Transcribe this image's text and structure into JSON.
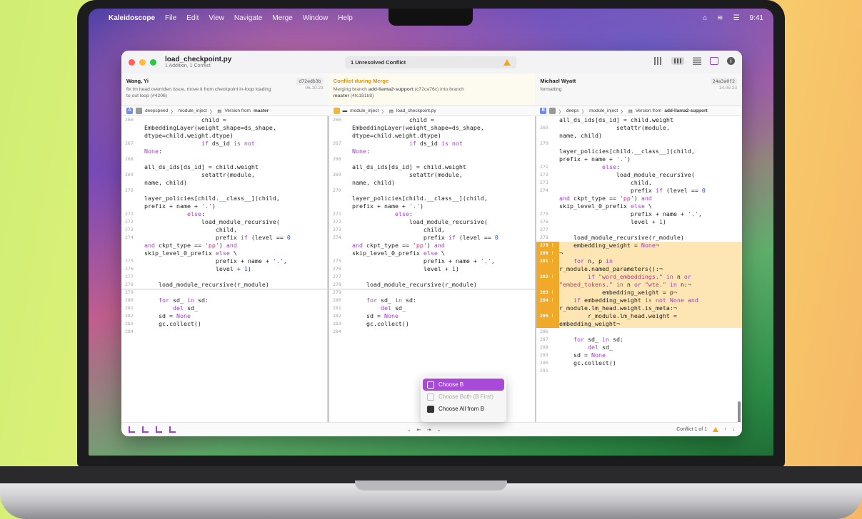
{
  "menubar": {
    "app": "Kaleidoscope",
    "items": [
      "File",
      "Edit",
      "View",
      "Navigate",
      "Merge",
      "Window",
      "Help"
    ],
    "clock": "9:41"
  },
  "window": {
    "title": "load_checkpoint.py",
    "subtitle": "1 Addition, 1 Conflict",
    "conflict_pill": "1 Unresolved Conflict"
  },
  "info": {
    "left": {
      "author": "Wang, Yi",
      "hash": "d72edb3b",
      "date": "06.10.23",
      "message": "fix lm head overriden issue, move it from checkpoint in-loop loading to out loop (#4206)"
    },
    "middle": {
      "title": "Conflict during Merge",
      "message_pre": "Merging branch ",
      "branch": "add-llama2-support",
      "message_mid": " (c72ca76c) into branch ",
      "target": "master",
      "message_post": " (4fc181b8)"
    },
    "right": {
      "author": "Michael Wyatt",
      "hash": "24a3a0f2",
      "date": "14.09.23",
      "message": "formatting"
    }
  },
  "paths": {
    "left": {
      "badge": "A",
      "parts": [
        "deepspeed",
        "module_inject"
      ],
      "file": "Version from ",
      "file_strong": "master"
    },
    "middle": {
      "badge": "M",
      "parts": [
        "module_inject"
      ],
      "file": "load_checkpoint.py"
    },
    "right": {
      "badge": "B",
      "parts": [
        "deeps",
        "module_inject"
      ],
      "file": "Version from ",
      "file_strong": "add-llama2-support"
    }
  },
  "code": {
    "base": [
      {
        "n": "266",
        "t": "                child ="
      },
      {
        "n": "",
        "t": "EmbeddingLayer(weight_shape=ds_shape,"
      },
      {
        "n": "",
        "t": "dtype=child.weight.dtype)"
      },
      {
        "n": "267",
        "t": "                if ds_id is not"
      },
      {
        "n": "",
        "t": "None:"
      },
      {
        "n": "268",
        "t": ""
      },
      {
        "n": "",
        "t": "all_ds_ids[ds_id] = child.weight"
      },
      {
        "n": "269",
        "t": "                setattr(module,"
      },
      {
        "n": "",
        "t": "name, child)"
      },
      {
        "n": "270",
        "t": ""
      },
      {
        "n": "",
        "t": "layer_policies[child.__class__](child,"
      },
      {
        "n": "",
        "t": "prefix + name + '.')"
      },
      {
        "n": "271",
        "t": "            else:"
      },
      {
        "n": "272",
        "t": "                load_module_recursive("
      },
      {
        "n": "273",
        "t": "                    child,"
      },
      {
        "n": "274",
        "t": "                    prefix if (level == 0"
      },
      {
        "n": "",
        "t": "and ckpt_type == 'pp') and"
      },
      {
        "n": "",
        "t": "skip_level_0_prefix else \\"
      },
      {
        "n": "275",
        "t": "                    prefix + name + '.',"
      },
      {
        "n": "276",
        "t": "                    level + 1)"
      },
      {
        "n": "277",
        "t": ""
      },
      {
        "n": "278",
        "t": "    load_module_recursive(r_module)"
      },
      {
        "n": "279",
        "t": ""
      },
      {
        "n": "280",
        "t": "    for sd_ in sd:"
      },
      {
        "n": "281",
        "t": "        del sd_"
      },
      {
        "n": "282",
        "t": "    sd = None"
      },
      {
        "n": "283",
        "t": "    gc.collect()"
      },
      {
        "n": "284",
        "t": ""
      }
    ],
    "right": [
      {
        "n": "",
        "t": "all_ds_ids[ds_id] = child.weight",
        "h": false
      },
      {
        "n": "269",
        "t": "                setattr(module,",
        "h": false
      },
      {
        "n": "",
        "t": "name, child)",
        "h": false
      },
      {
        "n": "270",
        "t": "",
        "h": false
      },
      {
        "n": "",
        "t": "layer_policies[child.__class__](child,",
        "h": false
      },
      {
        "n": "",
        "t": "prefix + name + '.')",
        "h": false
      },
      {
        "n": "271",
        "t": "            else:",
        "h": false
      },
      {
        "n": "272",
        "t": "                load_module_recursive(",
        "h": false
      },
      {
        "n": "273",
        "t": "                    child,",
        "h": false
      },
      {
        "n": "274",
        "t": "                    prefix if (level == 0",
        "h": false
      },
      {
        "n": "",
        "t": "and ckpt_type == 'pp') and",
        "h": false
      },
      {
        "n": "",
        "t": "skip_level_0_prefix else \\",
        "h": false
      },
      {
        "n": "275",
        "t": "                    prefix + name + '.',",
        "h": false
      },
      {
        "n": "276",
        "t": "                    level + 1)",
        "h": false
      },
      {
        "n": "277",
        "t": "",
        "h": false
      },
      {
        "n": "278",
        "t": "    load_module_recursive(r_module)",
        "h": false
      },
      {
        "n": "279 !",
        "t": "    embedding_weight = None¬",
        "h": true
      },
      {
        "n": "280 !",
        "t": "¬",
        "h": true
      },
      {
        "n": "281 !",
        "t": "    for n, p in",
        "h": true
      },
      {
        "n": "",
        "t": "r_module.named_parameters():¬",
        "h": true
      },
      {
        "n": "282 !",
        "t": "        if \"word_embeddings.\" in n or",
        "h": true
      },
      {
        "n": "",
        "t": "\"embed_tokens.\" in n or \"wte.\" in n:¬",
        "h": true
      },
      {
        "n": "283 !",
        "t": "            embedding_weight = p¬",
        "h": true
      },
      {
        "n": "284 !",
        "t": "    if embedding_weight is not None and",
        "h": true
      },
      {
        "n": "",
        "t": "r_module.lm_head.weight.is_meta:¬",
        "h": true
      },
      {
        "n": "285 !",
        "t": "        r_module.lm_head.weight =",
        "h": true
      },
      {
        "n": "",
        "t": "embedding_weight¬",
        "h": true
      },
      {
        "n": "286",
        "t": "",
        "h": false
      },
      {
        "n": "287",
        "t": "    for sd_ in sd:",
        "h": false
      },
      {
        "n": "288",
        "t": "        del sd_",
        "h": false
      },
      {
        "n": "289",
        "t": "    sd = None",
        "h": false
      },
      {
        "n": "290",
        "t": "    gc.collect()",
        "h": false
      },
      {
        "n": "291",
        "t": "",
        "h": false
      }
    ]
  },
  "popup": {
    "items": [
      {
        "label": "Choose B",
        "state": "selected"
      },
      {
        "label": "Choose Both (B First)",
        "state": "disabled"
      },
      {
        "label": "Choose All from B",
        "state": "normal"
      }
    ]
  },
  "bottom": {
    "conflict_counter": "Conflict 1 of 1"
  },
  "colors": {
    "accent": "#a949d9",
    "conflict": "#f1a92a",
    "conflict_bg": "#fde6b3",
    "keyword": "#a63cc8"
  }
}
